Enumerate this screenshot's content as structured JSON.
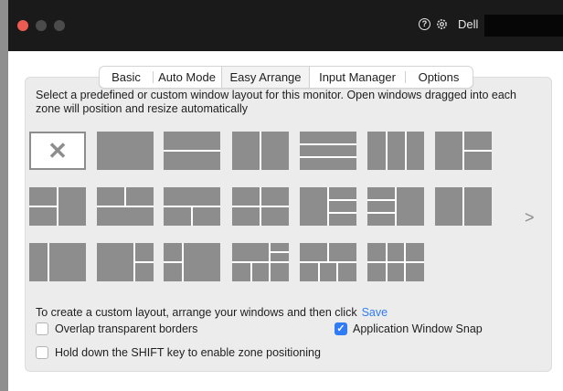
{
  "window": {
    "brand": "Dell",
    "help_icon": "help-icon",
    "settings_icon": "gear-icon"
  },
  "tabs": [
    {
      "label": "Basic",
      "active": false
    },
    {
      "label": "Auto Mode",
      "active": false
    },
    {
      "label": "Easy Arrange",
      "active": true
    },
    {
      "label": "Input Manager",
      "active": false
    },
    {
      "label": "Options",
      "active": false
    }
  ],
  "description": "Select a predefined or custom window layout for this monitor.  Open windows dragged into each zone will position and resize automatically",
  "layouts": {
    "count": 20,
    "selected_index": 0,
    "next_label": ">"
  },
  "custom": {
    "text": "To create a custom layout, arrange your windows and then click",
    "save_label": "Save"
  },
  "options": [
    {
      "label": "Overlap transparent borders",
      "checked": false
    },
    {
      "label": "Application Window Snap",
      "checked": true
    },
    {
      "label": "Hold down the SHIFT key to enable zone positioning",
      "checked": false
    }
  ],
  "colors": {
    "accent": "#2f7cf6",
    "tile": "#8d8d8d",
    "panel": "#ececec"
  }
}
